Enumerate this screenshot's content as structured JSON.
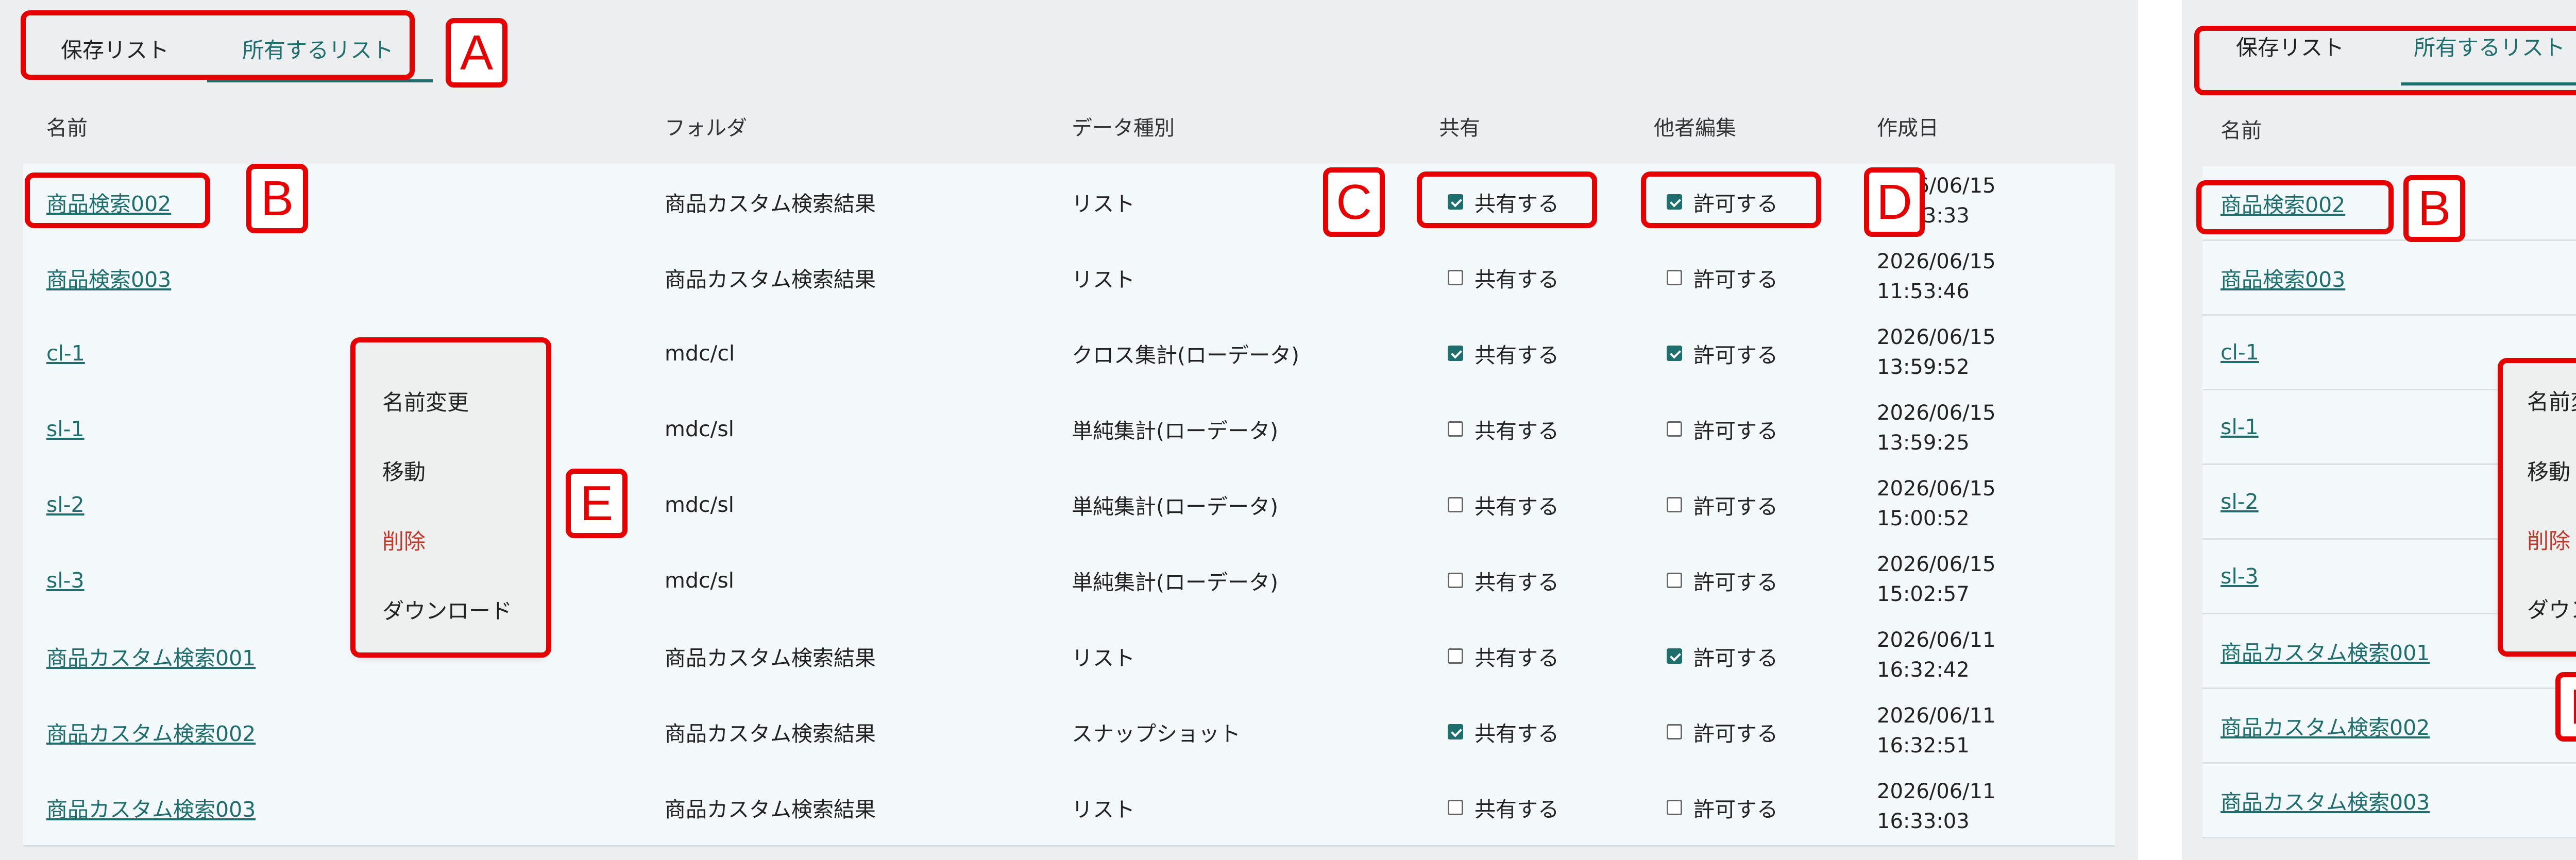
{
  "tabs": {
    "saved": "保存リスト",
    "owned": "所有するリスト"
  },
  "columns": {
    "name": "名前",
    "folder": "フォルダ",
    "data_type": "データ種別",
    "share": "共有",
    "others_edit": "他者編集",
    "created": "作成日"
  },
  "rows": [
    {
      "name": "商品検索002",
      "folder": "商品カスタム検索結果",
      "type": "リスト",
      "share": "共有する",
      "share_checked": true,
      "edit": "許可する",
      "edit_checked": true,
      "date": "2026/06/15",
      "time": "11:53:33"
    },
    {
      "name": "商品検索003",
      "folder": "商品カスタム検索結果",
      "type": "リスト",
      "share": "共有する",
      "share_checked": false,
      "edit": "許可する",
      "edit_checked": false,
      "date": "2026/06/15",
      "time": "11:53:46"
    },
    {
      "name": "cl-1",
      "folder": "mdc/cl",
      "type": "クロス集計(ローデータ)",
      "share": "共有する",
      "share_checked": true,
      "edit": "許可する",
      "edit_checked": true,
      "date": "2026/06/15",
      "time": "13:59:52"
    },
    {
      "name": "sl-1",
      "folder": "mdc/sl",
      "type": "単純集計(ローデータ)",
      "share": "共有する",
      "share_checked": false,
      "edit": "許可する",
      "edit_checked": false,
      "date": "2026/06/15",
      "time": "13:59:25"
    },
    {
      "name": "sl-2",
      "folder": "mdc/sl",
      "type": "単純集計(ローデータ)",
      "share": "共有する",
      "share_checked": false,
      "edit": "許可する",
      "edit_checked": false,
      "date": "2026/06/15",
      "time": "15:00:52"
    },
    {
      "name": "sl-3",
      "folder": "mdc/sl",
      "type": "単純集計(ローデータ)",
      "share": "共有する",
      "share_checked": false,
      "edit": "許可する",
      "edit_checked": false,
      "date": "2026/06/15",
      "time": "15:02:57"
    },
    {
      "name": "商品カスタム検索001",
      "folder": "商品カスタム検索結果",
      "type": "リスト",
      "share": "共有する",
      "share_checked": false,
      "edit": "許可する",
      "edit_checked": true,
      "date": "2026/06/11",
      "time": "16:32:42"
    },
    {
      "name": "商品カスタム検索002",
      "folder": "商品カスタム検索結果",
      "type": "スナップショット",
      "share": "共有する",
      "share_checked": true,
      "edit": "許可する",
      "edit_checked": false,
      "date": "2026/06/11",
      "time": "16:32:51"
    },
    {
      "name": "商品カスタム検索003",
      "folder": "商品カスタム検索結果",
      "type": "リスト",
      "share": "共有する",
      "share_checked": false,
      "edit": "許可する",
      "edit_checked": false,
      "date": "2026/06/11",
      "time": "16:33:03"
    }
  ],
  "menu": {
    "rename": "名前変更",
    "move": "移動",
    "delete": "削除",
    "download": "ダウンロード"
  },
  "annotations": {
    "a": "A",
    "b": "B",
    "c": "C",
    "d": "D",
    "e": "E"
  },
  "colors": {
    "accent": "#1e6e6e",
    "annotation": "#e60000",
    "danger": "#c0392b"
  }
}
